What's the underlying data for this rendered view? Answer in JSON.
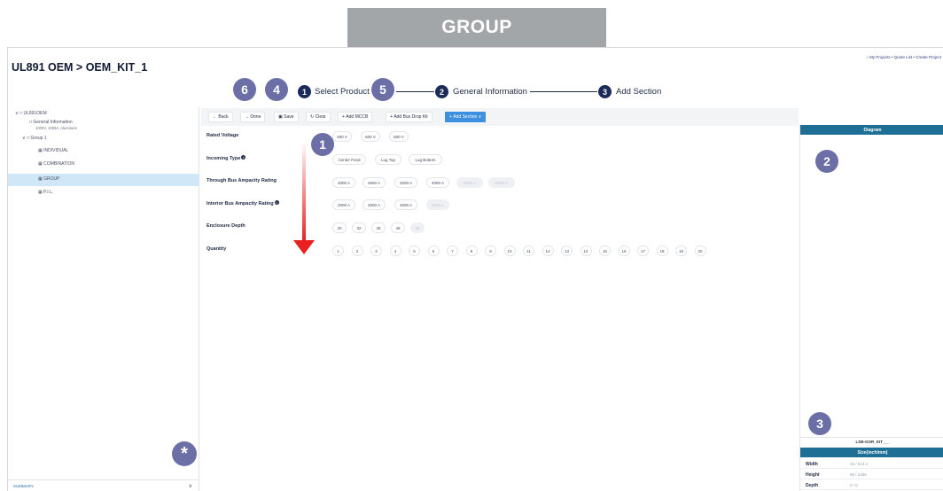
{
  "banner": {
    "title": "GROUP"
  },
  "app": {
    "title": "UL891 OEM > OEM_KIT_1",
    "top_links": "My Projects • Quote List • Create Project"
  },
  "annotations": {
    "b1": "1",
    "b2": "2",
    "b3": "3",
    "b4": "4",
    "b5": "5",
    "b6": "6",
    "star": "*",
    "arrow_color": "#e8201f"
  },
  "stepper": [
    {
      "num": "1",
      "label": "Select Product"
    },
    {
      "num": "2",
      "label": "General Information"
    },
    {
      "num": "3",
      "label": "Add Section"
    }
  ],
  "sidebar": {
    "root": "UL891OEM",
    "general": "General Information",
    "general_sub": "1000V, 1000A, Aluminum",
    "group": "Group 1",
    "items": [
      "INDIVIDUAL",
      "COMBINATION",
      "GROUP",
      "P.I.L."
    ],
    "summary": "SUMMARY"
  },
  "toolbar": {
    "back": "Back",
    "done": "Done",
    "save": "Save",
    "clear": "Clear",
    "add_mccb": "Add MCCB",
    "add_bus_drop": "Add Bus Drop Kit",
    "add_section": "Add Section"
  },
  "form": {
    "rated_voltage": {
      "label": "Rated Voltage",
      "options": [
        "480 V",
        "600 V",
        "600 V"
      ]
    },
    "incoming_type": {
      "label": "Incoming Type",
      "options": [
        "Center Feed",
        "Lug Top",
        "Lug Bottom"
      ]
    },
    "through_bus": {
      "label": "Through Bus Ampacity Rating",
      "options": [
        "2000 A",
        "2500 A",
        "3200 A",
        "4000 A",
        "5000 A",
        "6000 A"
      ]
    },
    "interior_bus": {
      "label": "Interior Bus Ampacity Rating",
      "options": [
        "2000 A",
        "3000 A",
        "4000 A",
        "5000 A"
      ]
    },
    "enclosure_depth": {
      "label": "Enclosure Depth",
      "options": [
        "20",
        "32",
        "38",
        "48",
        "60"
      ]
    },
    "quantity": {
      "label": "Quantity",
      "options": [
        "1",
        "2",
        "3",
        "4",
        "5",
        "6",
        "7",
        "8",
        "9",
        "10",
        "11",
        "12",
        "13",
        "14",
        "15",
        "16",
        "17",
        "18",
        "19",
        "20"
      ]
    }
  },
  "right_panel": {
    "diagram_title": "Diagram",
    "model": "LSB-GOR_KIT___",
    "size_title": "Size(inch/mm)",
    "rows": [
      {
        "key": "Width",
        "value": "35 / 914.4"
      },
      {
        "key": "Height",
        "value": "90 / 2286"
      },
      {
        "key": "Depth",
        "value": "0 / 0"
      }
    ]
  }
}
